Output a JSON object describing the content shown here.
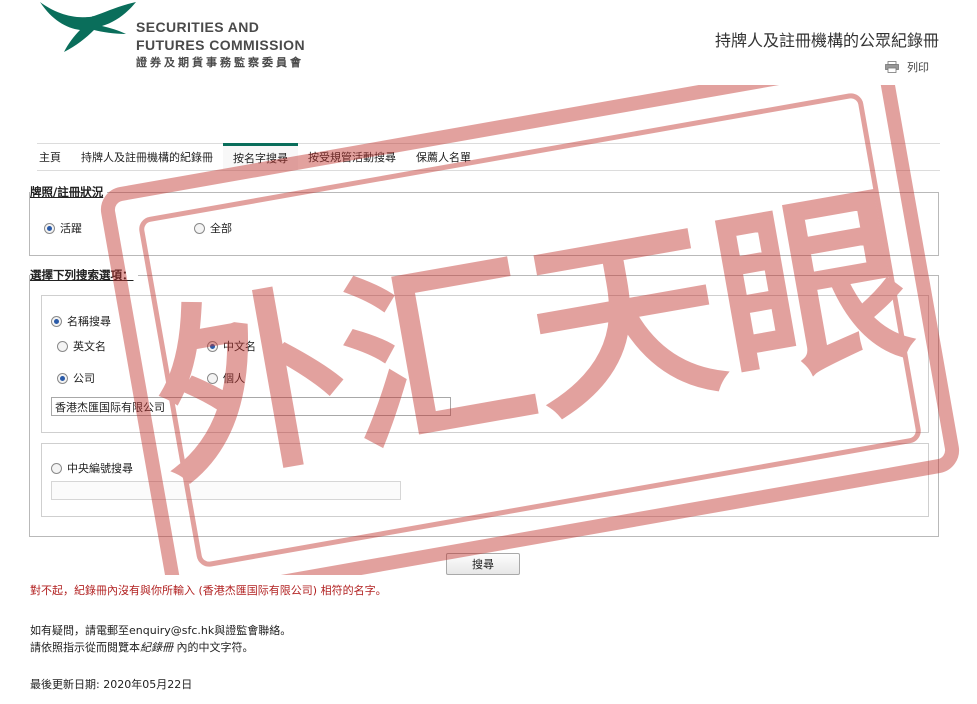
{
  "header": {
    "logo_en_line1": "SECURITIES AND",
    "logo_en_line2": "FUTURES COMMISSION",
    "logo_zh": "證券及期貨事務監察委員會",
    "register_title": "持牌人及註冊機構的公眾紀錄冊",
    "print_label": "列印",
    "brand_color": "#0a6e5b"
  },
  "tabs": [
    {
      "label": "主頁",
      "active": false
    },
    {
      "label": "持牌人及註冊機構的紀錄冊",
      "active": false
    },
    {
      "label": "按名字搜尋",
      "active": true
    },
    {
      "label": "按受規管活動搜尋",
      "active": false
    },
    {
      "label": "保薦人名單",
      "active": false
    }
  ],
  "license_status": {
    "legend": "牌照/註冊狀況",
    "options": [
      {
        "label": "活躍",
        "checked": true
      },
      {
        "label": "全部",
        "checked": false
      }
    ]
  },
  "search_options": {
    "legend": "選擇下列搜索選項：",
    "name_search": {
      "label": "名稱搜尋",
      "checked": true,
      "language_options": [
        {
          "label": "英文名",
          "checked": false
        },
        {
          "label": "中文名",
          "checked": true
        }
      ],
      "entity_options": [
        {
          "label": "公司",
          "checked": true
        },
        {
          "label": "個人",
          "checked": false
        }
      ],
      "input_value": "香港杰匯国际有限公司"
    },
    "ce_search": {
      "label": "中央編號搜尋",
      "checked": false,
      "input_value": ""
    }
  },
  "search_button": "搜尋",
  "messages": {
    "error": "對不起，紀錄冊內沒有與你所輸入 (香港杰匯国际有限公司) 相符的名字。",
    "contact_prefix": "如有疑問，請電郵至",
    "contact_email": "enquiry@sfc.hk",
    "contact_suffix": "與證監會聯絡。",
    "guide_prefix": "請依照指示從而閱覽本",
    "guide_italic": "紀錄冊",
    "guide_suffix": "內的中文字符。",
    "last_updated_label": "最後更新日期:",
    "last_updated_date": "2020年05月22日"
  },
  "watermark": {
    "text": "外汇天眼",
    "color": "#c0302b"
  }
}
